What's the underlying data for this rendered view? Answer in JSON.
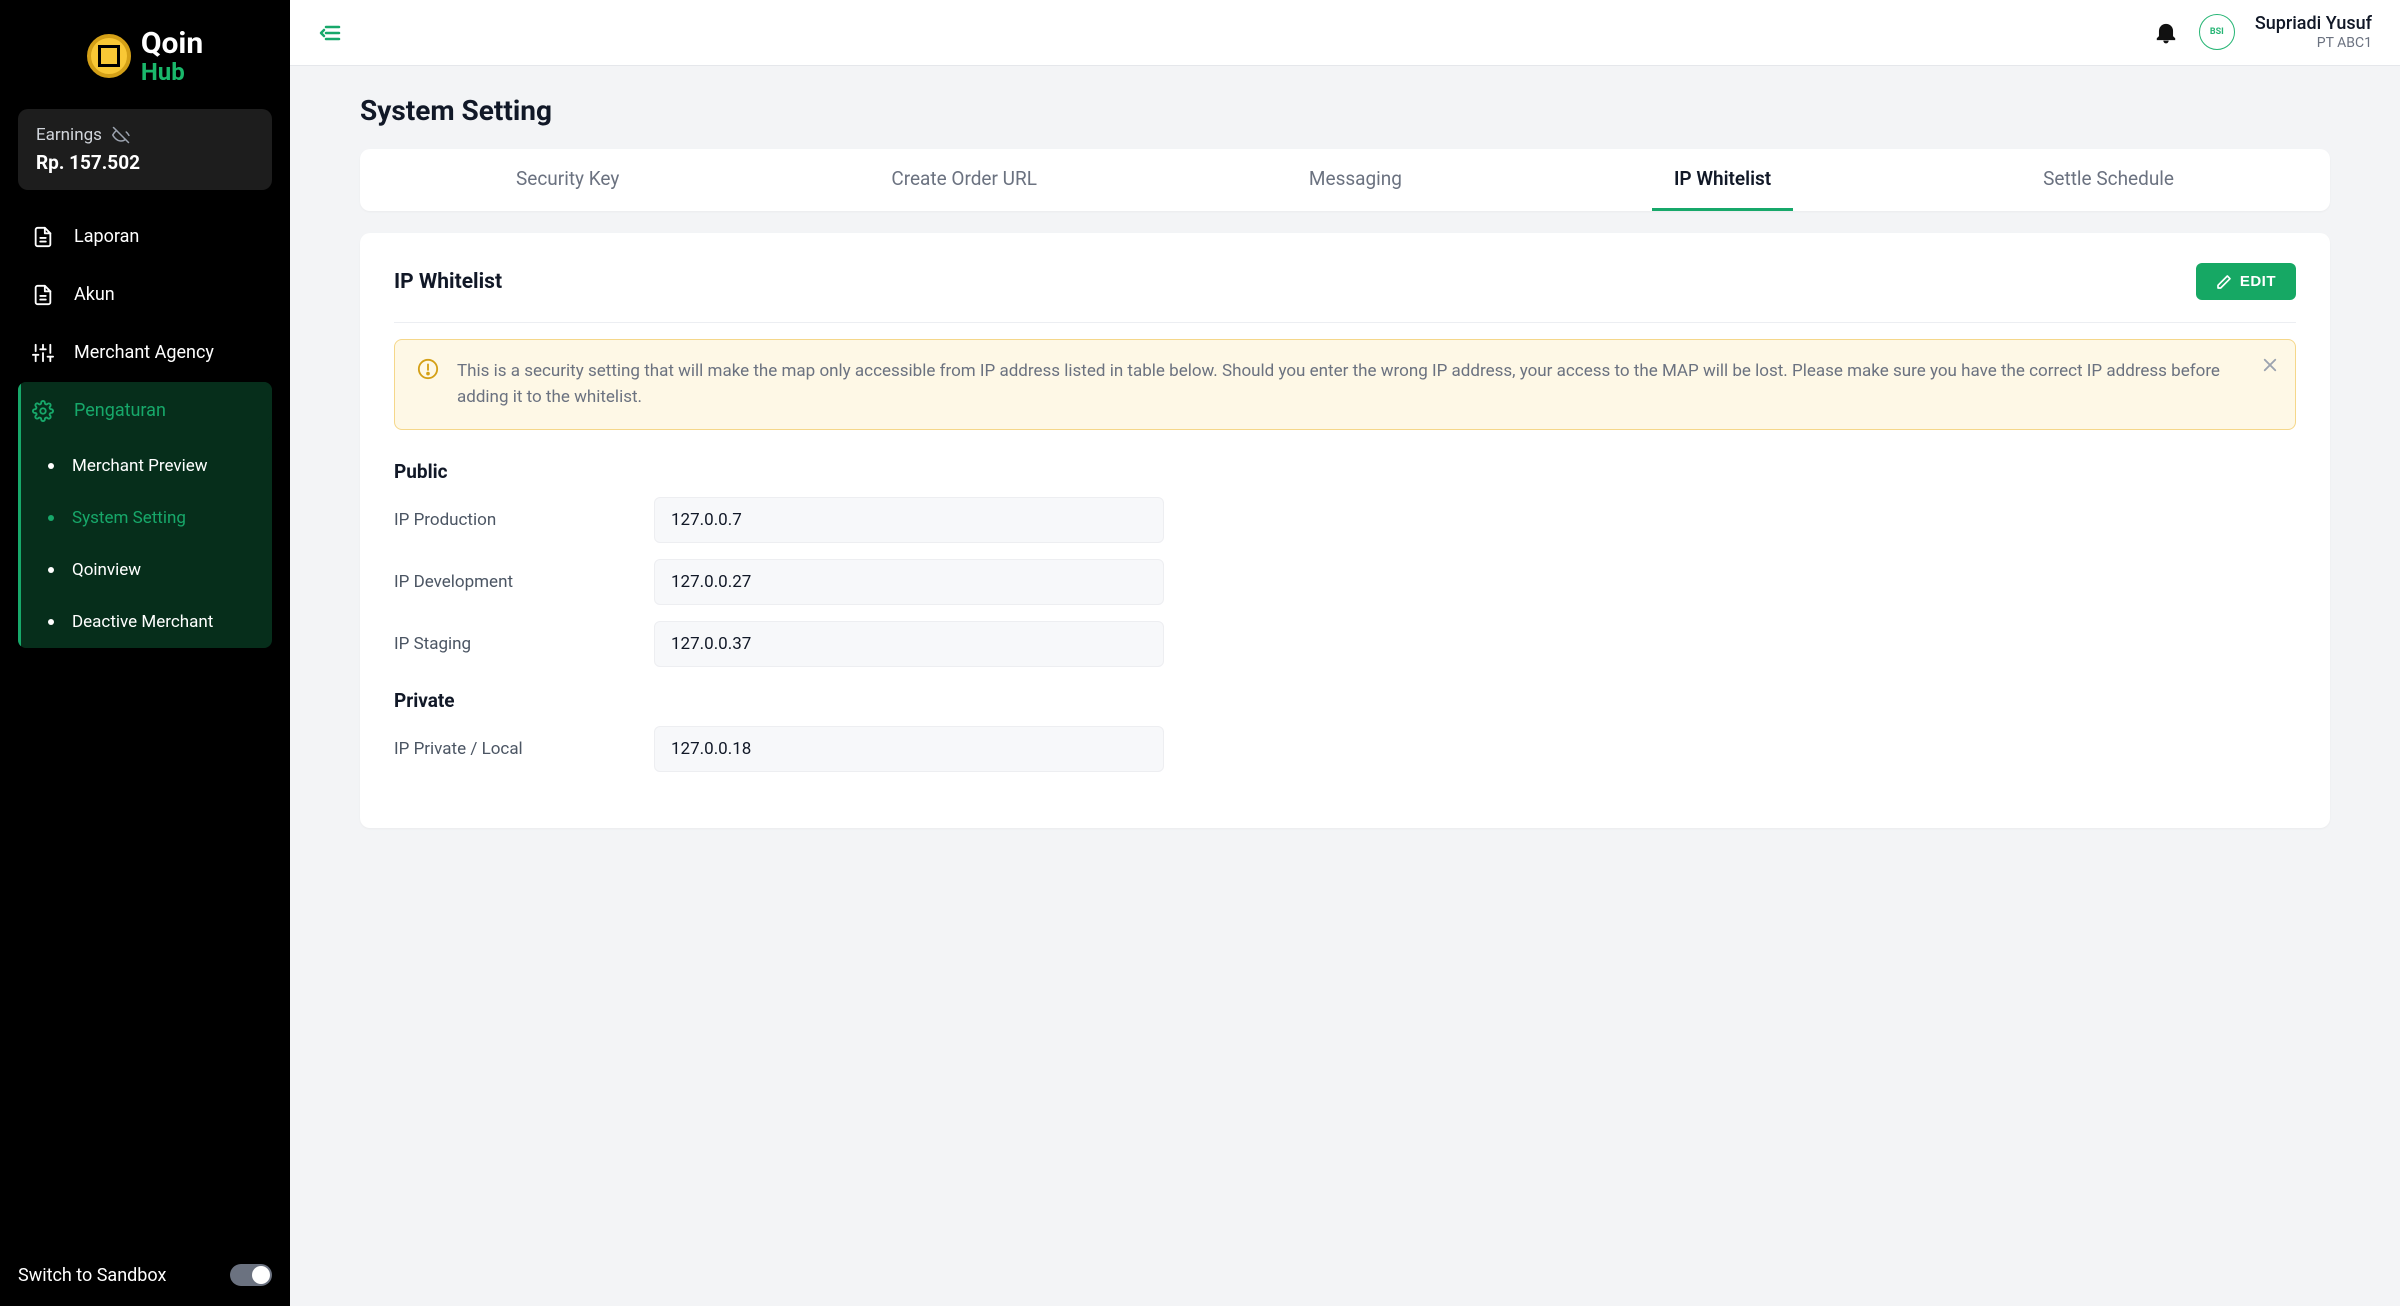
{
  "brand": {
    "name_top": "Qoin",
    "name_bottom": "Hub"
  },
  "earnings": {
    "label": "Earnings",
    "value": "Rp. 157.502"
  },
  "sidebar": {
    "items": [
      {
        "label": "Laporan"
      },
      {
        "label": "Akun"
      },
      {
        "label": "Merchant Agency"
      }
    ],
    "settings_group": {
      "label": "Pengaturan",
      "children": [
        {
          "label": "Merchant Preview"
        },
        {
          "label": "System Setting"
        },
        {
          "label": "Qoinview"
        },
        {
          "label": "Deactive Merchant"
        }
      ]
    },
    "sandbox_label": "Switch to Sandbox"
  },
  "header": {
    "user_name": "Supriadi Yusuf",
    "user_org": "PT ABC1",
    "avatar_badge": "BSI"
  },
  "page": {
    "title": "System Setting",
    "tabs": [
      "Security Key",
      "Create Order URL",
      "Messaging",
      "IP Whitelist",
      "Settle Schedule"
    ],
    "active_tab_index": 3,
    "panel_title": "IP Whitelist",
    "edit_label": "EDIT",
    "alert_text": "This is a security setting that will make the map only accessible from IP address listed in table below. Should you enter the wrong IP address, your access to the MAP will be lost. Please make sure you have the correct IP address before adding it to the whitelist.",
    "sections": [
      {
        "title": "Public",
        "rows": [
          {
            "label": "IP Production",
            "value": "127.0.0.7"
          },
          {
            "label": "IP Development",
            "value": "127.0.0.27"
          },
          {
            "label": "IP Staging",
            "value": "127.0.0.37"
          }
        ]
      },
      {
        "title": "Private",
        "rows": [
          {
            "label": "IP Private / Local",
            "value": "127.0.0.18"
          }
        ]
      }
    ]
  }
}
